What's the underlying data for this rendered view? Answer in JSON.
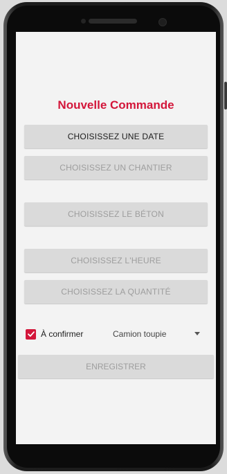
{
  "form": {
    "title": "Nouvelle Commande",
    "date_button": "CHOISISSEZ UNE DATE",
    "chantier_button": "CHOISISSEZ UN CHANTIER",
    "beton_button": "CHOISISSEZ LE BÉTON",
    "heure_button": "CHOISISSEZ L'HEURE",
    "quantite_button": "CHOISISSEZ LA QUANTITÉ",
    "confirm_label": "À confirmer",
    "confirm_checked": true,
    "truck_select_value": "Camion toupie",
    "save_button": "ENREGISTRER"
  },
  "colors": {
    "accent": "#d3163a",
    "button_bg": "#dadada",
    "disabled_text": "#9d9d9d",
    "screen_bg": "#f3f3f3"
  },
  "icons": {
    "checkbox": "check-icon",
    "dropdown": "chevron-down-icon"
  }
}
